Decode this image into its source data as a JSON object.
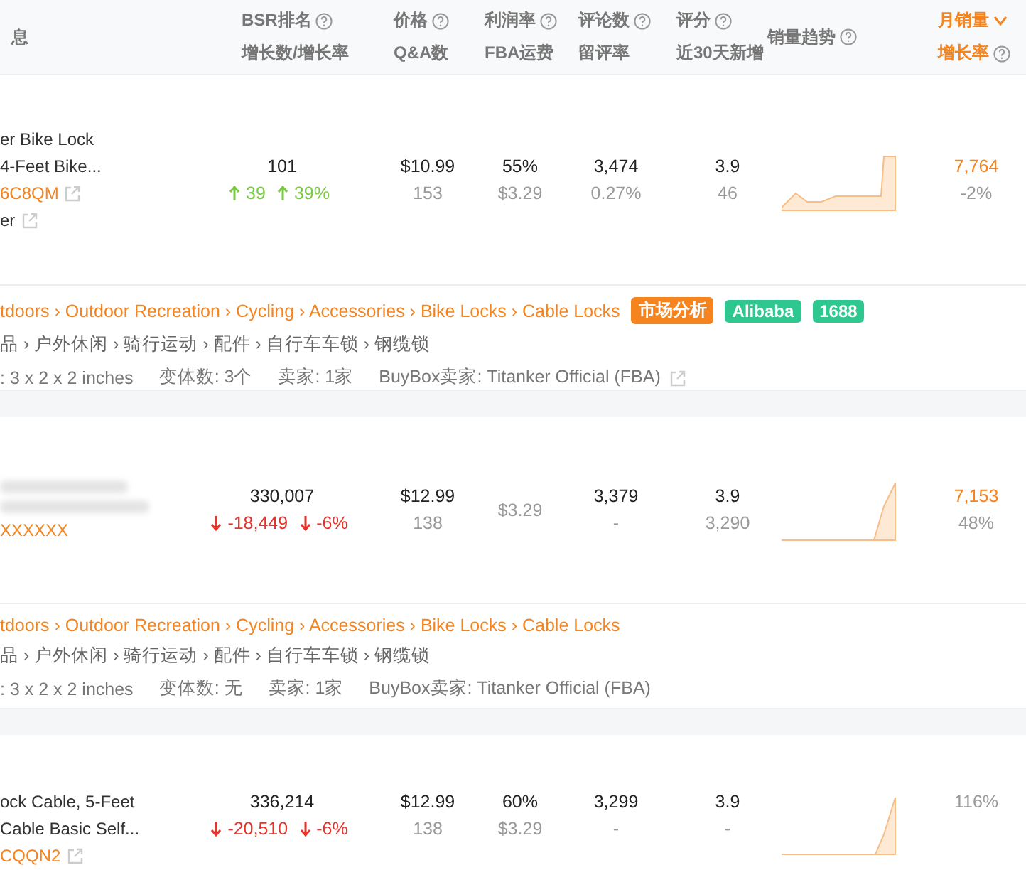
{
  "header": {
    "columns": [
      {
        "line1": "息"
      },
      {
        "line1": "BSR排名",
        "line2": "增长数/增长率",
        "help": true
      },
      {
        "line1": "价格",
        "line2": "Q&A数",
        "help": true
      },
      {
        "line1": "利润率",
        "line2": "FBA运费",
        "help": true
      },
      {
        "line1": "评论数",
        "line2": "留评率",
        "help": true
      },
      {
        "line1": "评分",
        "line2": "近30天新增",
        "help": true
      },
      {
        "line1": "销量趋势",
        "help": true
      },
      {
        "line1": "月销量",
        "line2": "增长率",
        "help": true,
        "sorted": true
      }
    ]
  },
  "products": [
    {
      "title_lines": [
        "er Bike Lock",
        "4-Feet Bike..."
      ],
      "blurred": false,
      "asin": "6C8QM",
      "asin_link": true,
      "brand": "er",
      "bsr": "101",
      "bsr_change": [
        {
          "value": "39",
          "kind": "up"
        },
        {
          "value": "39%",
          "kind": "up"
        }
      ],
      "price": "$10.99",
      "qa": "153",
      "profit": "55%",
      "fba": "$3.29",
      "reviews": "3,474",
      "review_rate": "0.27%",
      "rating": "3.9",
      "new_reviews": "46",
      "sales": "7,764",
      "growth": "-2%",
      "details": {
        "category_en": "tdoors › Outdoor Recreation › Cycling › Accessories › Bike Locks › Cable Locks",
        "tags": [
          {
            "label": "市场分析",
            "color": "#f5841f"
          },
          {
            "label": "Alibaba",
            "color": "#2ec78f"
          },
          {
            "label": "1688",
            "color": "#2ec78f"
          }
        ],
        "category_zh": "品 › 户外休闲 › 骑行运动 › 配件 › 自行车车锁 › 钢缆锁",
        "facts": [
          ": 3 x 2 x 2 inches",
          "变体数: 3个",
          "卖家: 1家",
          "BuyBox卖家:  Titanker Official (FBA)"
        ],
        "buybox_link": true
      }
    },
    {
      "blurred": true,
      "asin": "XXXXXX",
      "asin_link": false,
      "bsr": "330,007",
      "bsr_change": [
        {
          "value": "-18,449",
          "kind": "down"
        },
        {
          "value": "-6%",
          "kind": "down"
        }
      ],
      "price": "$12.99",
      "qa": "138",
      "fba": "$3.29",
      "reviews": "3,379",
      "review_rate": "-",
      "rating": "3.9",
      "new_reviews": "3,290",
      "sales": "7,153",
      "growth": "48%",
      "details": {
        "category_en": "tdoors › Outdoor Recreation › Cycling › Accessories › Bike Locks › Cable Locks",
        "category_zh": "品 › 户外休闲 › 骑行运动 › 配件 › 自行车车锁 › 钢缆锁",
        "facts": [
          ": 3 x 2 x 2 inches",
          "变体数: 无",
          "卖家: 1家",
          "BuyBox卖家:  Titanker Official (FBA)"
        ],
        "buybox_link": false
      }
    },
    {
      "title_lines": [
        "ock Cable, 5-Feet",
        "Cable Basic Self..."
      ],
      "blurred": false,
      "asin": "CQQN2",
      "asin_link": true,
      "bsr": "336,214",
      "bsr_change": [
        {
          "value": "-20,510",
          "kind": "down"
        },
        {
          "value": "-6%",
          "kind": "down"
        }
      ],
      "price": "$12.99",
      "qa": "138",
      "profit": "60%",
      "fba": "$3.29",
      "reviews": "3,299",
      "review_rate": "-",
      "rating": "3.9",
      "new_reviews": "-",
      "growth": "116%"
    }
  ]
}
